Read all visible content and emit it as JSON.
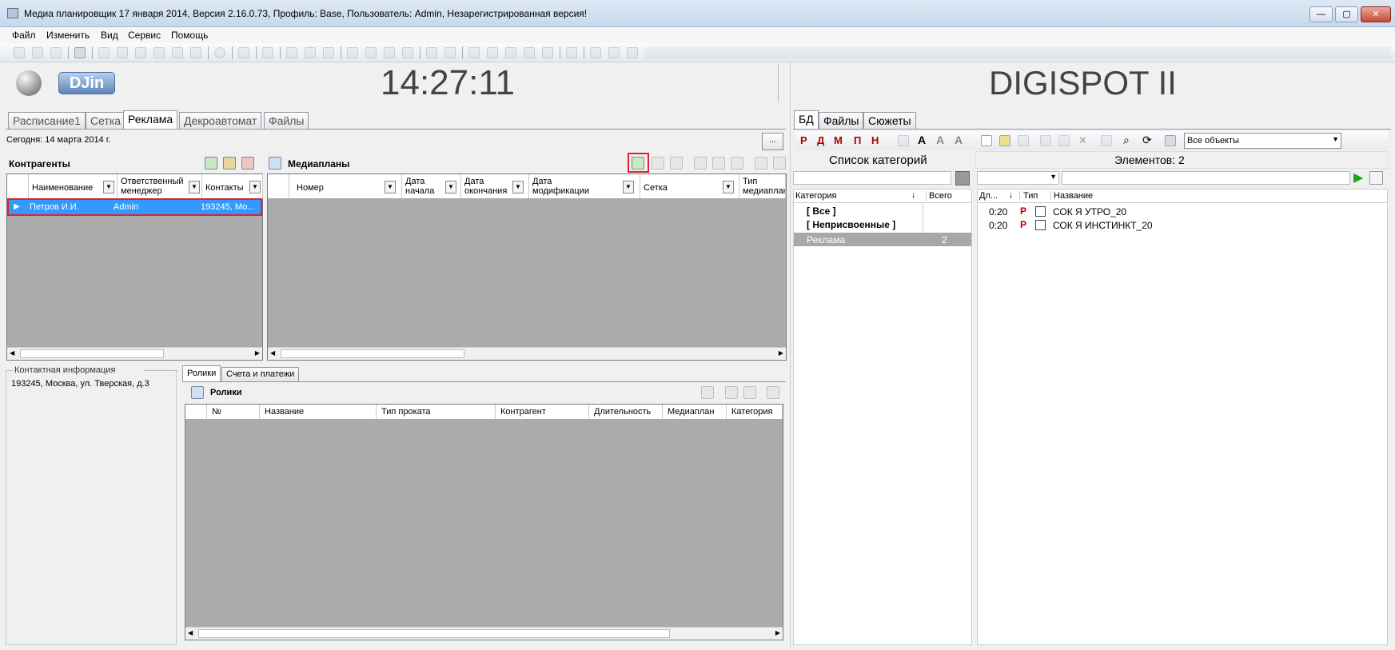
{
  "window": {
    "title": "Медиа планировщик 17 января 2014, Версия 2.16.0.73, Профиль: Base, Пользователь: Admin, Незарегистрированная версия!"
  },
  "menu": [
    "Файл",
    "Изменить",
    "Вид",
    "Сервис",
    "Помощь"
  ],
  "header": {
    "logo": "DJin",
    "clock": "14:27:11",
    "product": "DIGISPOT II"
  },
  "tabs": [
    "Расписание1",
    "Сетка",
    "Реклама",
    "Декроавтомат",
    "Файлы"
  ],
  "today": "Сегодня: 14 марта 2014 г.",
  "ellipsis": "...",
  "contractors": {
    "title": "Контрагенты",
    "columns": [
      "Наименование",
      "Ответственный менеджер",
      "Контакты"
    ],
    "rows": [
      {
        "name": "Петров И.И.",
        "manager": "Admin",
        "contacts": "193245, Мо..."
      }
    ]
  },
  "mediaplans": {
    "title": "Медиапланы",
    "columns": [
      "Номер",
      "Дата начала",
      "Дата окончания",
      "Дата модификации",
      "Сетка",
      "Тип медиаплан"
    ]
  },
  "contact_info": {
    "title": "Контактная информация",
    "text": "193245, Москва, ул. Тверская, д.3"
  },
  "bottom_tabs": [
    "Ролики",
    "Счета и платежи"
  ],
  "clips": {
    "title": "Ролики",
    "columns": [
      "№",
      "Название",
      "Тип проката",
      "Контрагент",
      "Длительность",
      "Медиаплан",
      "Категория"
    ]
  },
  "right_tabs": [
    "БД",
    "Файлы",
    "Сюжеты"
  ],
  "right_toolbar": {
    "letters": [
      "Р",
      "Д",
      "М",
      "П",
      "Н"
    ],
    "filter": "Все объекты"
  },
  "categories": {
    "title": "Список категорий",
    "col_category": "Категория",
    "col_total": "Всего",
    "rows": [
      {
        "name": "[ Все ]",
        "total": ""
      },
      {
        "name": "[ Неприсвоенные ]",
        "total": ""
      },
      {
        "name": "Реклама",
        "total": "2"
      }
    ]
  },
  "elements": {
    "title": "Элементов: 2",
    "columns": [
      "Дл...",
      "Тип",
      "Название"
    ],
    "rows": [
      {
        "dur": "0:20",
        "name": "СОК Я УТРО_20"
      },
      {
        "dur": "0:20",
        "name": "СОК Я ИНСТИНКТ_20"
      }
    ]
  }
}
